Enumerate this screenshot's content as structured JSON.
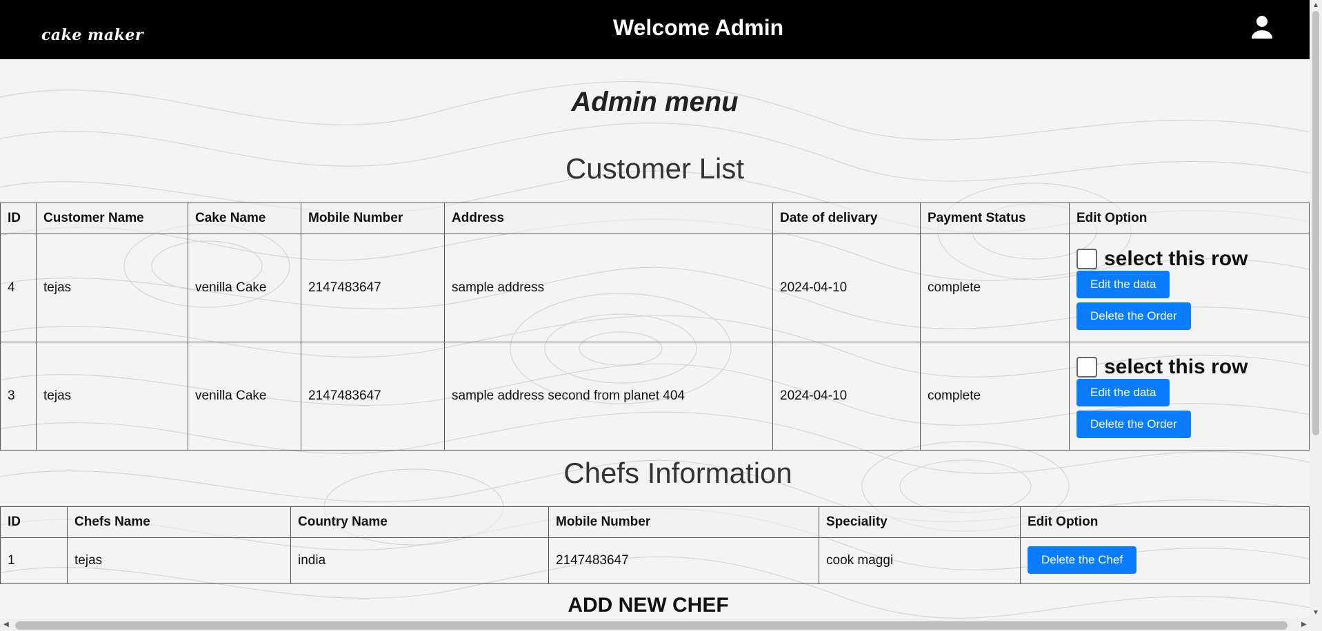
{
  "header": {
    "logo": "cake maker",
    "welcome": "Welcome Admin",
    "user_icon": "user-icon"
  },
  "page": {
    "admin_title": "Admin menu"
  },
  "customers": {
    "title": "Customer List",
    "columns": [
      "ID",
      "Customer Name",
      "Cake Name",
      "Mobile Number",
      "Address",
      "Date of delivary",
      "Payment Status",
      "Edit Option"
    ],
    "rows": [
      {
        "id": "4",
        "name": "tejas",
        "cake": "venilla Cake",
        "mobile": "2147483647",
        "address": "sample address",
        "date": "2024-04-10",
        "status": "complete"
      },
      {
        "id": "3",
        "name": "tejas",
        "cake": "venilla Cake",
        "mobile": "2147483647",
        "address": "sample address second from planet 404",
        "date": "2024-04-10",
        "status": "complete"
      }
    ],
    "select_label": "select this row",
    "edit_label": "Edit the data",
    "delete_label": "Delete the Order"
  },
  "chefs": {
    "title": "Chefs Information",
    "columns": [
      "ID",
      "Chefs Name",
      "Country Name",
      "Mobile Number",
      "Speciality",
      "Edit Option"
    ],
    "rows": [
      {
        "id": "1",
        "name": "tejas",
        "country": "india",
        "mobile": "2147483647",
        "speciality": "cook maggi"
      }
    ],
    "delete_label": "Delete the Chef"
  },
  "add_chef": {
    "title": "ADD NEW CHEF"
  },
  "colors": {
    "navbar": "#000000",
    "button": "#0a7cff"
  }
}
